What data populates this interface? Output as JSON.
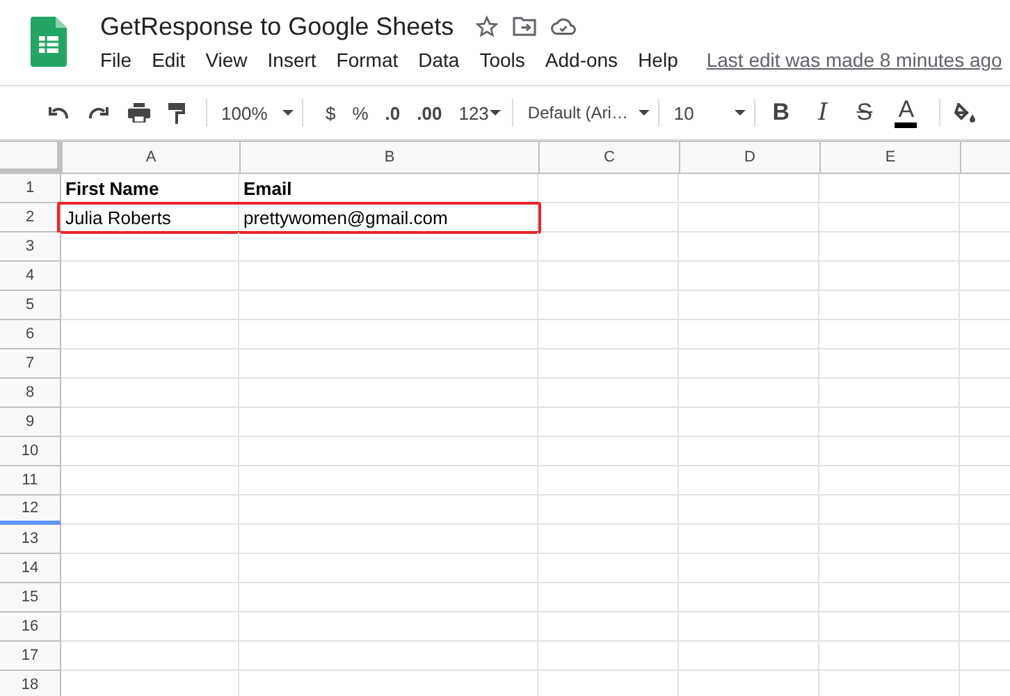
{
  "doc": {
    "title": "GetResponse to Google Sheets"
  },
  "menu": [
    "File",
    "Edit",
    "View",
    "Insert",
    "Format",
    "Data",
    "Tools",
    "Add-ons",
    "Help"
  ],
  "last_edit": "Last edit was made 8 minutes ago",
  "toolbar": {
    "zoom": "100%",
    "currency": "$",
    "percent": "%",
    "decrease_decimals": ".0",
    "increase_decimals": ".00",
    "more_formats": "123",
    "font": "Default (Ari…",
    "font_size": "10",
    "format_buttons": [
      {
        "kind": "bold",
        "label": "B"
      },
      {
        "kind": "italic",
        "label": "I"
      },
      {
        "kind": "strike",
        "label": "S"
      },
      {
        "kind": "color",
        "label": "A"
      }
    ]
  },
  "columns": [
    "A",
    "B",
    "C",
    "D",
    "E"
  ],
  "rows": [
    {
      "number": "1",
      "cells": [
        "First Name",
        "Email"
      ],
      "bold": true,
      "highlighted": false,
      "frozen_after": false
    },
    {
      "number": "2",
      "cells": [
        "Julia Roberts",
        "prettywomen@gmail.com"
      ],
      "bold": false,
      "highlighted": true,
      "frozen_after": false
    },
    {
      "number": "3",
      "cells": [],
      "highlighted": false,
      "frozen_after": false
    },
    {
      "number": "4",
      "cells": [],
      "highlighted": false,
      "frozen_after": false
    },
    {
      "number": "5",
      "cells": [],
      "highlighted": false,
      "frozen_after": false
    },
    {
      "number": "6",
      "cells": [],
      "highlighted": false,
      "frozen_after": false
    },
    {
      "number": "7",
      "cells": [],
      "highlighted": false,
      "frozen_after": false
    },
    {
      "number": "8",
      "cells": [],
      "highlighted": false,
      "frozen_after": false
    },
    {
      "number": "9",
      "cells": [],
      "highlighted": false,
      "frozen_after": false
    },
    {
      "number": "10",
      "cells": [],
      "highlighted": false,
      "frozen_after": false
    },
    {
      "number": "11",
      "cells": [],
      "highlighted": false,
      "frozen_after": false
    },
    {
      "number": "12",
      "cells": [],
      "highlighted": false,
      "frozen_after": true
    },
    {
      "number": "13",
      "cells": [],
      "highlighted": false,
      "frozen_after": false
    },
    {
      "number": "14",
      "cells": [],
      "highlighted": false,
      "frozen_after": false
    },
    {
      "number": "15",
      "cells": [],
      "highlighted": false,
      "frozen_after": false
    },
    {
      "number": "16",
      "cells": [],
      "highlighted": false,
      "frozen_after": false
    },
    {
      "number": "17",
      "cells": [],
      "highlighted": false,
      "frozen_after": false
    },
    {
      "number": "18",
      "cells": [],
      "highlighted": false,
      "frozen_after": false
    }
  ]
}
